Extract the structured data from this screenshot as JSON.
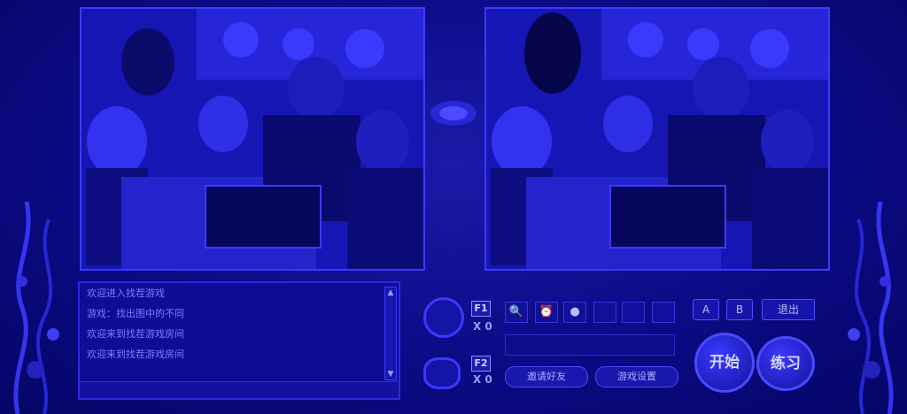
{
  "chat": {
    "lines": [
      "欢迎进入找茬游戏",
      "游戏：找出图中的不同",
      "欢迎来到找茬游戏房间",
      "欢迎来到找茬游戏房间"
    ]
  },
  "players": {
    "p1": {
      "key": "F1",
      "count": "X 0"
    },
    "p2": {
      "key": "F2",
      "count": "X 0"
    }
  },
  "buttons": {
    "a": "A",
    "b": "B",
    "exit": "退出",
    "pill_left": "邀请好友",
    "pill_right": "游戏设置",
    "start": "开始",
    "practice": "练习"
  },
  "icons": [
    "magnifier-icon",
    "clock-icon",
    "bomb-icon"
  ],
  "colors": {
    "accent": "#3b3bff",
    "background": "#0a0a7a"
  }
}
